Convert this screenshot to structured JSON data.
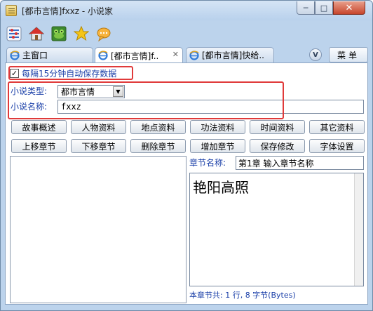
{
  "window": {
    "title": "[都市言情]fxxz - 小说家"
  },
  "toolbar": {
    "icons": [
      "settings-grid-icon",
      "home-icon",
      "frog-game-icon",
      "star-icon",
      "chat-icon"
    ]
  },
  "tabs": [
    {
      "label": "主窗口",
      "active": false
    },
    {
      "label": "[都市言情]f..",
      "active": true
    },
    {
      "label": "[都市言情]快给..",
      "active": false
    }
  ],
  "tabbar": {
    "v_label": "V",
    "menu_label": "菜单"
  },
  "autosave": {
    "checked": true,
    "label": "每隔15分钟自动保存数据"
  },
  "form": {
    "type_label": "小说类型:",
    "type_value": "都市言情",
    "name_label": "小说名称:",
    "name_value": "fxxz"
  },
  "buttons_row1": [
    "故事概述",
    "人物资料",
    "地点资料",
    "功法资料",
    "时间资料",
    "其它资料"
  ],
  "buttons_row2": [
    "上移章节",
    "下移章节",
    "删除章节",
    "增加章节",
    "保存修改",
    "字体设置"
  ],
  "chapter": {
    "name_label": "章节名称:",
    "name_value": "第1章  输入章节名称",
    "content": "艳阳高照",
    "status": "本章节共: 1 行, 8 字节(Bytes)"
  },
  "colors": {
    "highlight_box": "#e03a3a",
    "label_blue": "#1a3fa8"
  }
}
